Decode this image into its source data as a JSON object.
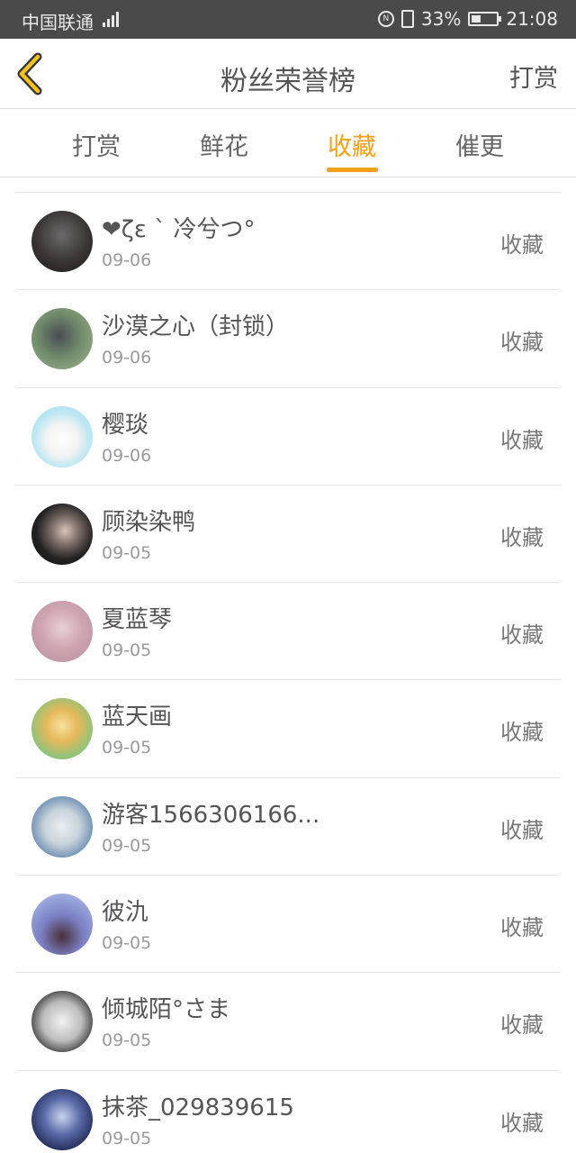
{
  "status_bar": {
    "carrier": "中国联通",
    "network": "4G",
    "battery": "33%",
    "time": "21:08"
  },
  "nav": {
    "title": "粉丝荣誉榜",
    "action": "打赏"
  },
  "tabs": [
    {
      "label": "打赏"
    },
    {
      "label": "鲜花"
    },
    {
      "label": "收藏"
    },
    {
      "label": "催更"
    }
  ],
  "active_tab": "收藏",
  "accent_color": "#f0a21a",
  "fans": [
    {
      "name": "❤ζε ` 冷兮つ°",
      "date": "09-06",
      "action": "收藏"
    },
    {
      "name": "沙漠之心（封锁）",
      "date": "09-06",
      "action": "收藏"
    },
    {
      "name": "樱琰",
      "date": "09-06",
      "action": "收藏"
    },
    {
      "name": "顾染染鸭",
      "date": "09-05",
      "action": "收藏"
    },
    {
      "name": "夏蓝琴",
      "date": "09-05",
      "action": "收藏"
    },
    {
      "name": "蓝天画",
      "date": "09-05",
      "action": "收藏"
    },
    {
      "name": "游客1566306166...",
      "date": "09-05",
      "action": "收藏"
    },
    {
      "name": "彼氿",
      "date": "09-05",
      "action": "收藏"
    },
    {
      "name": "倾城陌°さま",
      "date": "09-05",
      "action": "收藏"
    },
    {
      "name": "抹茶_029839615",
      "date": "09-05",
      "action": "收藏"
    }
  ]
}
